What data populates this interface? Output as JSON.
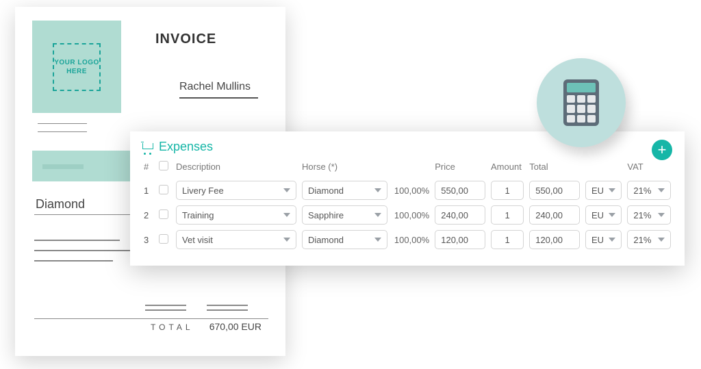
{
  "invoice": {
    "logo_text": "YOUR LOGO HERE",
    "title": "INVOICE",
    "customer_name": "Rachel Mullins",
    "item_label": "Diamond",
    "total_label": "TOTAL",
    "total_value": "670,00 EUR"
  },
  "expenses": {
    "title": "Expenses",
    "columns": {
      "num": "#",
      "description": "Description",
      "horse": "Horse (*)",
      "price": "Price",
      "amount": "Amount",
      "total": "Total",
      "vat": "VAT"
    },
    "rows": [
      {
        "n": "1",
        "description": "Livery Fee",
        "horse": "Diamond",
        "pct": "100,00%",
        "price": "550,00",
        "amount": "1",
        "total": "550,00",
        "region": "EU",
        "vat": "21%"
      },
      {
        "n": "2",
        "description": "Training",
        "horse": "Sapphire",
        "pct": "100,00%",
        "price": "240,00",
        "amount": "1",
        "total": "240,00",
        "region": "EU",
        "vat": "21%"
      },
      {
        "n": "3",
        "description": "Vet visit",
        "horse": "Diamond",
        "pct": "100,00%",
        "price": "120,00",
        "amount": "1",
        "total": "120,00",
        "region": "EU",
        "vat": "21%"
      }
    ]
  }
}
